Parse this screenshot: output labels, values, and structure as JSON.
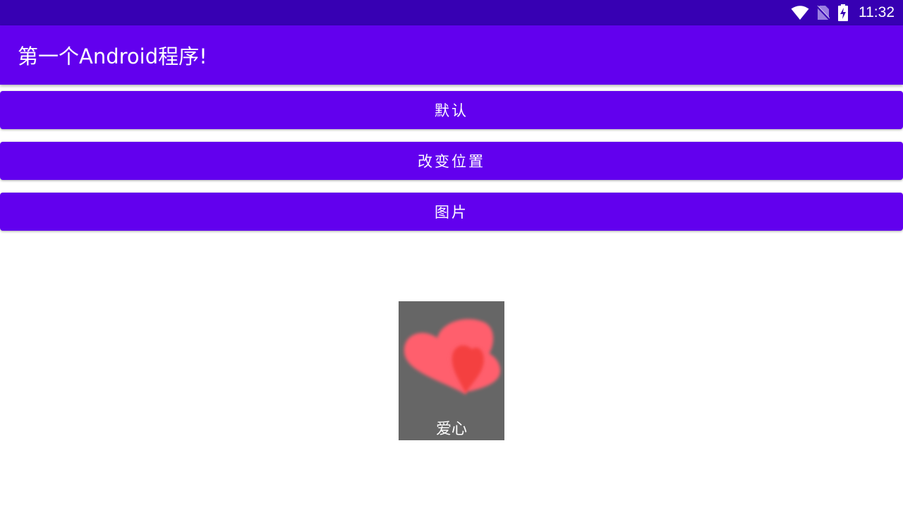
{
  "status_bar": {
    "time": "11:32",
    "icons": [
      "wifi-icon",
      "no-sim-icon",
      "battery-charging-icon"
    ]
  },
  "app_bar": {
    "title": "第一个Android程序!"
  },
  "buttons": {
    "default_label": "默认",
    "change_position_label": "改变位置",
    "image_label": "图片"
  },
  "image_card": {
    "caption": "爱心",
    "icon": "hearts-image"
  },
  "colors": {
    "status_bar": "#3700b3",
    "primary": "#6200ee",
    "card_background": "#666666",
    "heart_light": "#ff5f6d",
    "heart_dark": "#f44040"
  }
}
